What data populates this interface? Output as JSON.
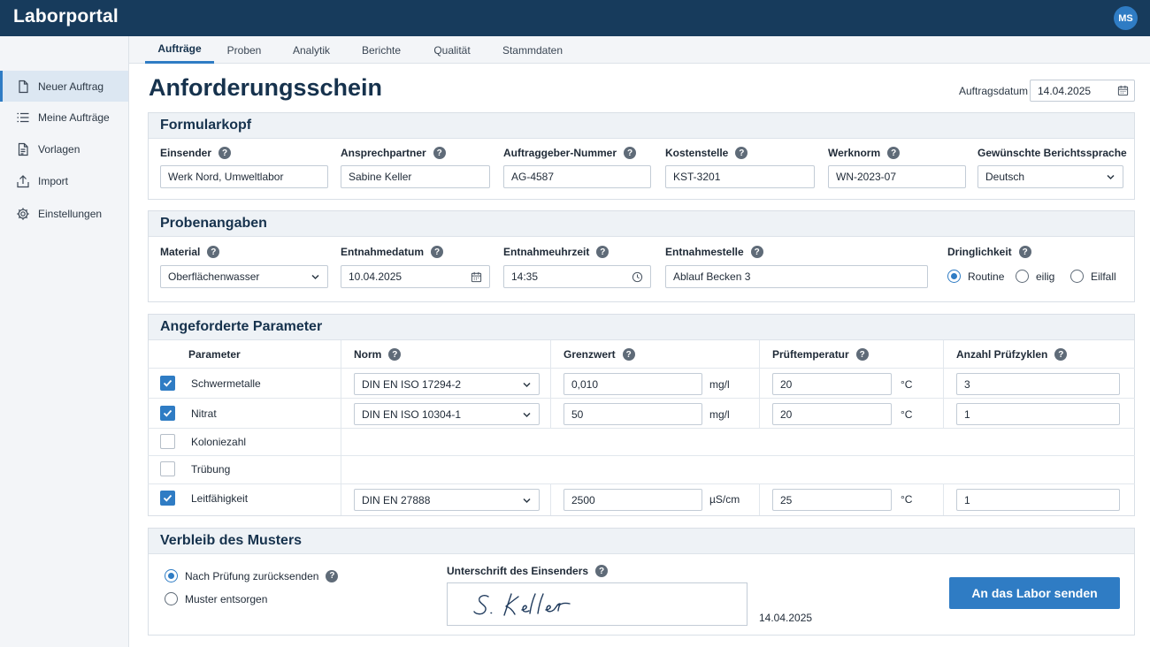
{
  "app": {
    "title": "Laborportal",
    "user_initials": "MS"
  },
  "sidebar": {
    "items": [
      {
        "label": "Neuer Auftrag",
        "icon": "document-icon",
        "active": true
      },
      {
        "label": "Meine Aufträge",
        "icon": "list-icon",
        "active": false
      },
      {
        "label": "Vorlagen",
        "icon": "template-icon",
        "active": false
      },
      {
        "label": "Import",
        "icon": "upload-icon",
        "active": false
      },
      {
        "label": "Einstellungen",
        "icon": "gear-icon",
        "active": false
      }
    ]
  },
  "tabs": [
    {
      "label": "Aufträge",
      "active": true
    },
    {
      "label": "Proben",
      "active": false
    },
    {
      "label": "Analytik",
      "active": false
    },
    {
      "label": "Berichte",
      "active": false
    },
    {
      "label": "Qualität",
      "active": false
    },
    {
      "label": "Stammdaten",
      "active": false
    }
  ],
  "page": {
    "title": "Anforderungsschein",
    "order_date_label": "Auftragsdatum",
    "order_date": "14.04.2025"
  },
  "header_section": {
    "title": "Formularkopf",
    "fields": [
      {
        "label": "Einsender",
        "value": "Werk Nord, Umweltlabor"
      },
      {
        "label": "Ansprechpartner",
        "value": "Sabine Keller"
      },
      {
        "label": "Auftraggeber-Nummer",
        "value": "AG-4587"
      },
      {
        "label": "Kostenstelle",
        "value": "KST-3201"
      },
      {
        "label": "Werknorm",
        "value": "WN-2023-07"
      },
      {
        "label": "Gewünschte Berichtssprache",
        "value": "Deutsch"
      }
    ]
  },
  "sample_section": {
    "title": "Probenangaben",
    "material_label": "Material",
    "material": "Oberflächenwasser",
    "date_label": "Entnahmedatum",
    "date": "10.04.2025",
    "time_label": "Entnahmeuhrzeit",
    "time": "14:35",
    "location_label": "Entnahmestelle",
    "location": "Ablauf Becken 3",
    "urgency_label": "Dringlichkeit",
    "urgency_options": [
      "Routine",
      "eilig",
      "Eilfall"
    ],
    "urgency_selected": "Routine"
  },
  "params_section": {
    "title": "Angeforderte Parameter",
    "columns": [
      "Parameter",
      "Norm",
      "Grenzwert",
      "Prüftemperatur",
      "Anzahl Prüfzyklen"
    ],
    "rows": [
      {
        "checked": true,
        "name": "Schwermetalle",
        "norm": "DIN EN ISO 17294-2",
        "limit": "0,010",
        "limit_unit": "mg/l",
        "temp": "20",
        "temp_unit": "°C",
        "cycles": "3"
      },
      {
        "checked": true,
        "name": "Nitrat",
        "norm": "DIN EN ISO 10304-1",
        "limit": "50",
        "limit_unit": "mg/l",
        "temp": "20",
        "temp_unit": "°C",
        "cycles": "1"
      },
      {
        "checked": false,
        "name": "Koloniezahl"
      },
      {
        "checked": false,
        "name": "Trübung"
      },
      {
        "checked": true,
        "name": "Leitfähigkeit",
        "norm": "DIN EN 27888",
        "limit": "2500",
        "limit_unit": "µS/cm",
        "temp": "25",
        "temp_unit": "°C",
        "cycles": "1"
      }
    ]
  },
  "retention_section": {
    "title": "Verbleib des Musters",
    "options": [
      "Nach Prüfung zurücksenden",
      "Muster entsorgen"
    ],
    "selected": "Nach Prüfung zurücksenden",
    "signature_label": "Unterschrift des Einsenders",
    "signature_text": "S. Keller",
    "signature_date": "14.04.2025",
    "submit_label": "An das Labor senden"
  },
  "colors": {
    "topbar": "#173b5c",
    "accent": "#2f7cc4",
    "section_head": "#eef2f6",
    "title": "#16324d"
  }
}
